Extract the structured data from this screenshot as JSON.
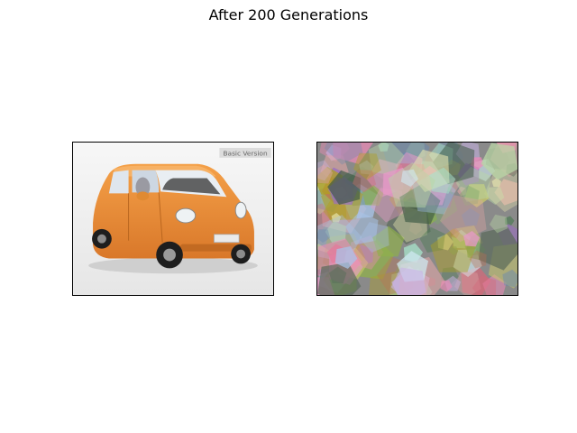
{
  "figure": {
    "title": "After 200 Generations"
  },
  "original_image": {
    "badge_text": "Basic Version",
    "car_color": "#f0953a",
    "background_color": "#f3f3f3"
  },
  "evolved_image": {
    "background_color": "#8a8a8a",
    "palette": [
      "#c9b3e6",
      "#b9d6a6",
      "#7da86a",
      "#4a7a52",
      "#e69ac6",
      "#a8c4e8",
      "#c9c96a",
      "#5a6a5a",
      "#e0a6a6",
      "#a6e0c9",
      "#b0a020",
      "#9a6fc0",
      "#d46a7a",
      "#6a8ab0",
      "#e8e6b0",
      "#3e5a44",
      "#f08ab8",
      "#cfe8f0",
      "#8fb04a",
      "#c07050"
    ]
  }
}
